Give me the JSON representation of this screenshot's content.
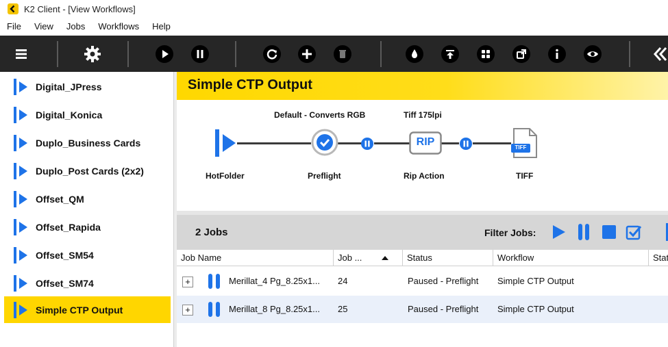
{
  "window": {
    "title": "K2 Client - [View Workflows]"
  },
  "menu": [
    "File",
    "View",
    "Jobs",
    "Workflows",
    "Help"
  ],
  "toolbar": {
    "buttons": [
      "menu-icon",
      "settings-gear-icon",
      "play-icon",
      "pause-icon",
      "refresh-icon",
      "add-icon",
      "delete-icon",
      "ink-drop-icon",
      "upload-icon",
      "grid-icon",
      "share-icon",
      "info-icon",
      "view-eye-icon",
      "logo-icon"
    ]
  },
  "sidebar": {
    "items": [
      {
        "label": "Digital_JPress",
        "selected": false
      },
      {
        "label": "Digital_Konica",
        "selected": false
      },
      {
        "label": "Duplo_Business Cards",
        "selected": false
      },
      {
        "label": "Duplo_Post Cards (2x2)",
        "selected": false
      },
      {
        "label": "Offset_QM",
        "selected": false
      },
      {
        "label": "Offset_Rapida",
        "selected": false
      },
      {
        "label": "Offset_SM54",
        "selected": false
      },
      {
        "label": "Offset_SM74",
        "selected": false
      },
      {
        "label": "Simple CTP Output",
        "selected": true
      }
    ]
  },
  "workflow": {
    "title": "Simple CTP Output",
    "steps": [
      {
        "name": "HotFolder",
        "sublabel": ""
      },
      {
        "name": "Preflight",
        "sublabel": "Default - Converts RGB"
      },
      {
        "name": "Rip Action",
        "sublabel": "Tiff 175lpi",
        "icon_text": "RIP"
      },
      {
        "name": "TIFF",
        "sublabel": "",
        "icon_text": "TIFF"
      }
    ]
  },
  "jobs": {
    "count_label": "2 Jobs",
    "filter_label": "Filter Jobs:",
    "columns": [
      "Job Name",
      "Job ...",
      "Status",
      "Workflow",
      "Stat"
    ],
    "rows": [
      {
        "name": "Merillat_4 Pg_8.25x1...",
        "job": "24",
        "status": "Paused - Preflight",
        "workflow": "Simple CTP Output"
      },
      {
        "name": "Merillat_8 Pg_8.25x1...",
        "job": "25",
        "status": "Paused - Preflight",
        "workflow": "Simple CTP Output"
      }
    ]
  },
  "colors": {
    "accent": "#ffd600",
    "blue": "#1e73e8",
    "toolbar": "#262626"
  }
}
